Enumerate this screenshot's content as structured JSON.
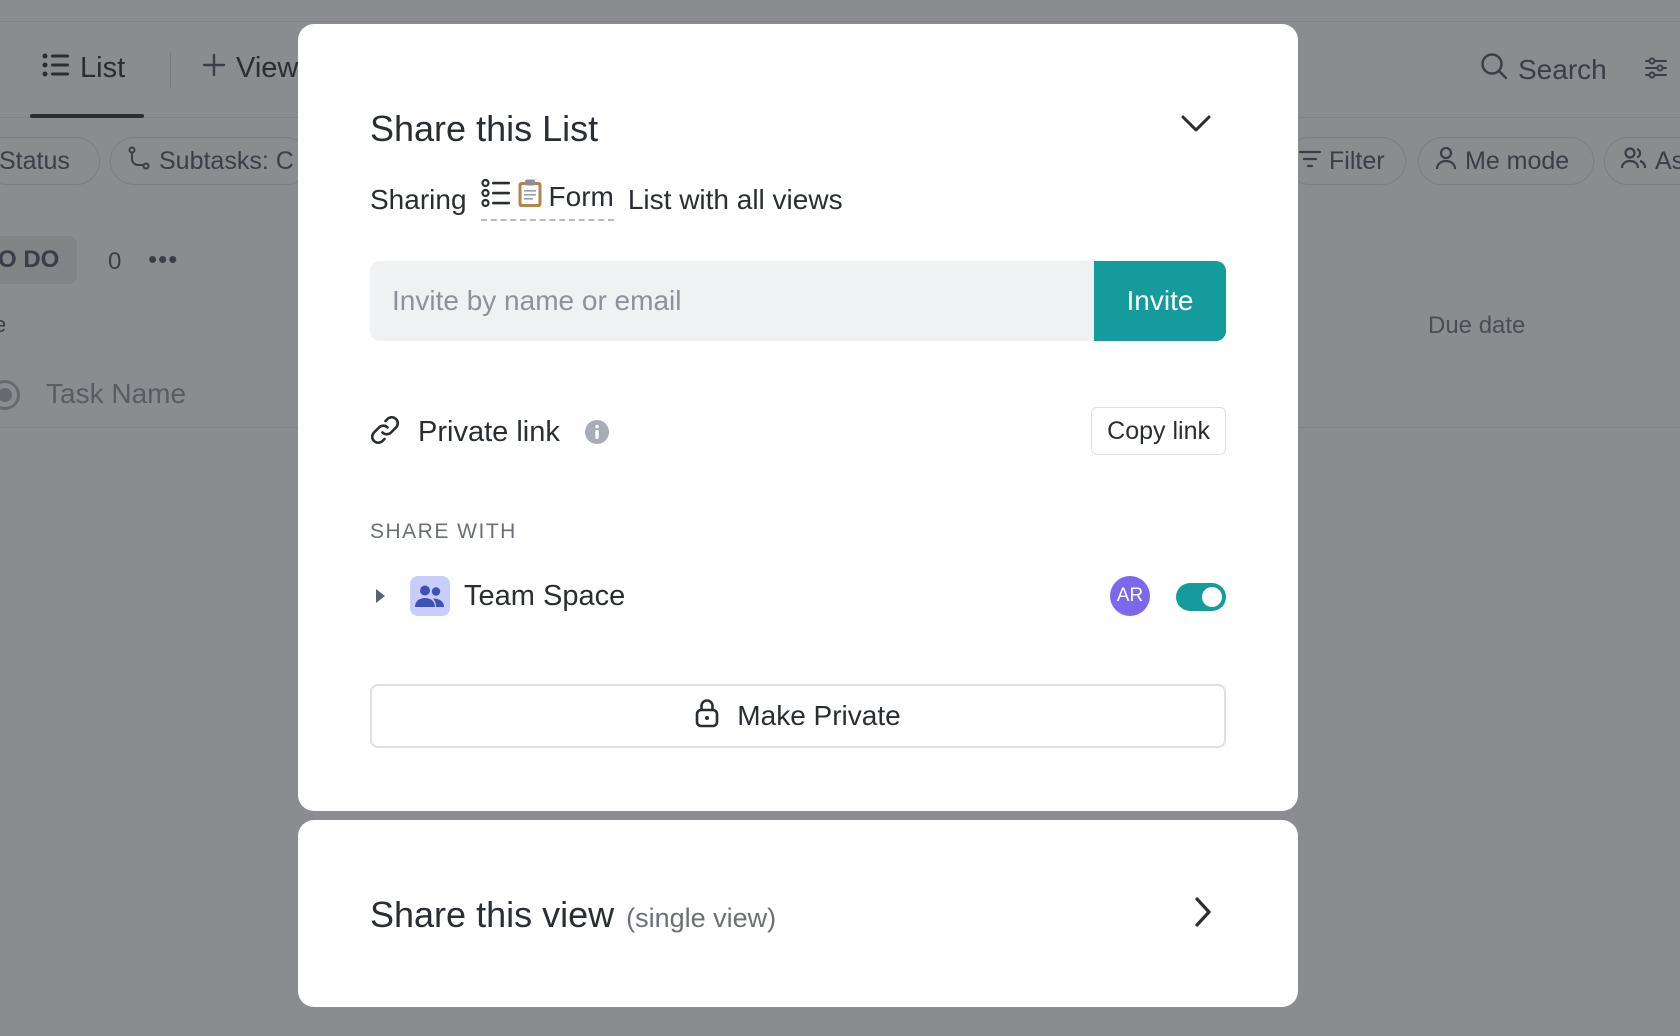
{
  "background": {
    "tabs": {
      "list_label": "List",
      "view_label": "View"
    },
    "search_label": "Search",
    "filters": {
      "status": "Status",
      "subtasks": "Subtasks: C",
      "filter": "Filter",
      "me_mode": "Me mode",
      "assignee": "As"
    },
    "group": {
      "label": "O DO",
      "count": "0"
    },
    "columns": {
      "left_fragment": "e",
      "due_date": "Due date"
    },
    "task_placeholder": "Task Name"
  },
  "share_list": {
    "title": "Share this List",
    "sharing_prefix": "Sharing",
    "sharing_target": "Form",
    "sharing_suffix": "List with all views",
    "invite_placeholder": "Invite by name or email",
    "invite_value": "",
    "invite_button": "Invite",
    "private_link_label": "Private link",
    "copy_link_button": "Copy link",
    "share_with_heading": "SHARE WITH",
    "team": {
      "name": "Team Space",
      "avatar_initials": "AR",
      "toggle_on": true
    },
    "make_private_button": "Make Private"
  },
  "share_view": {
    "title": "Share this view",
    "subtitle": "(single view)"
  },
  "colors": {
    "accent": "#149b9c",
    "avatar": "#7b68ee",
    "team_icon_bg": "#c9cdfc",
    "team_icon_fg": "#3f51b5"
  }
}
